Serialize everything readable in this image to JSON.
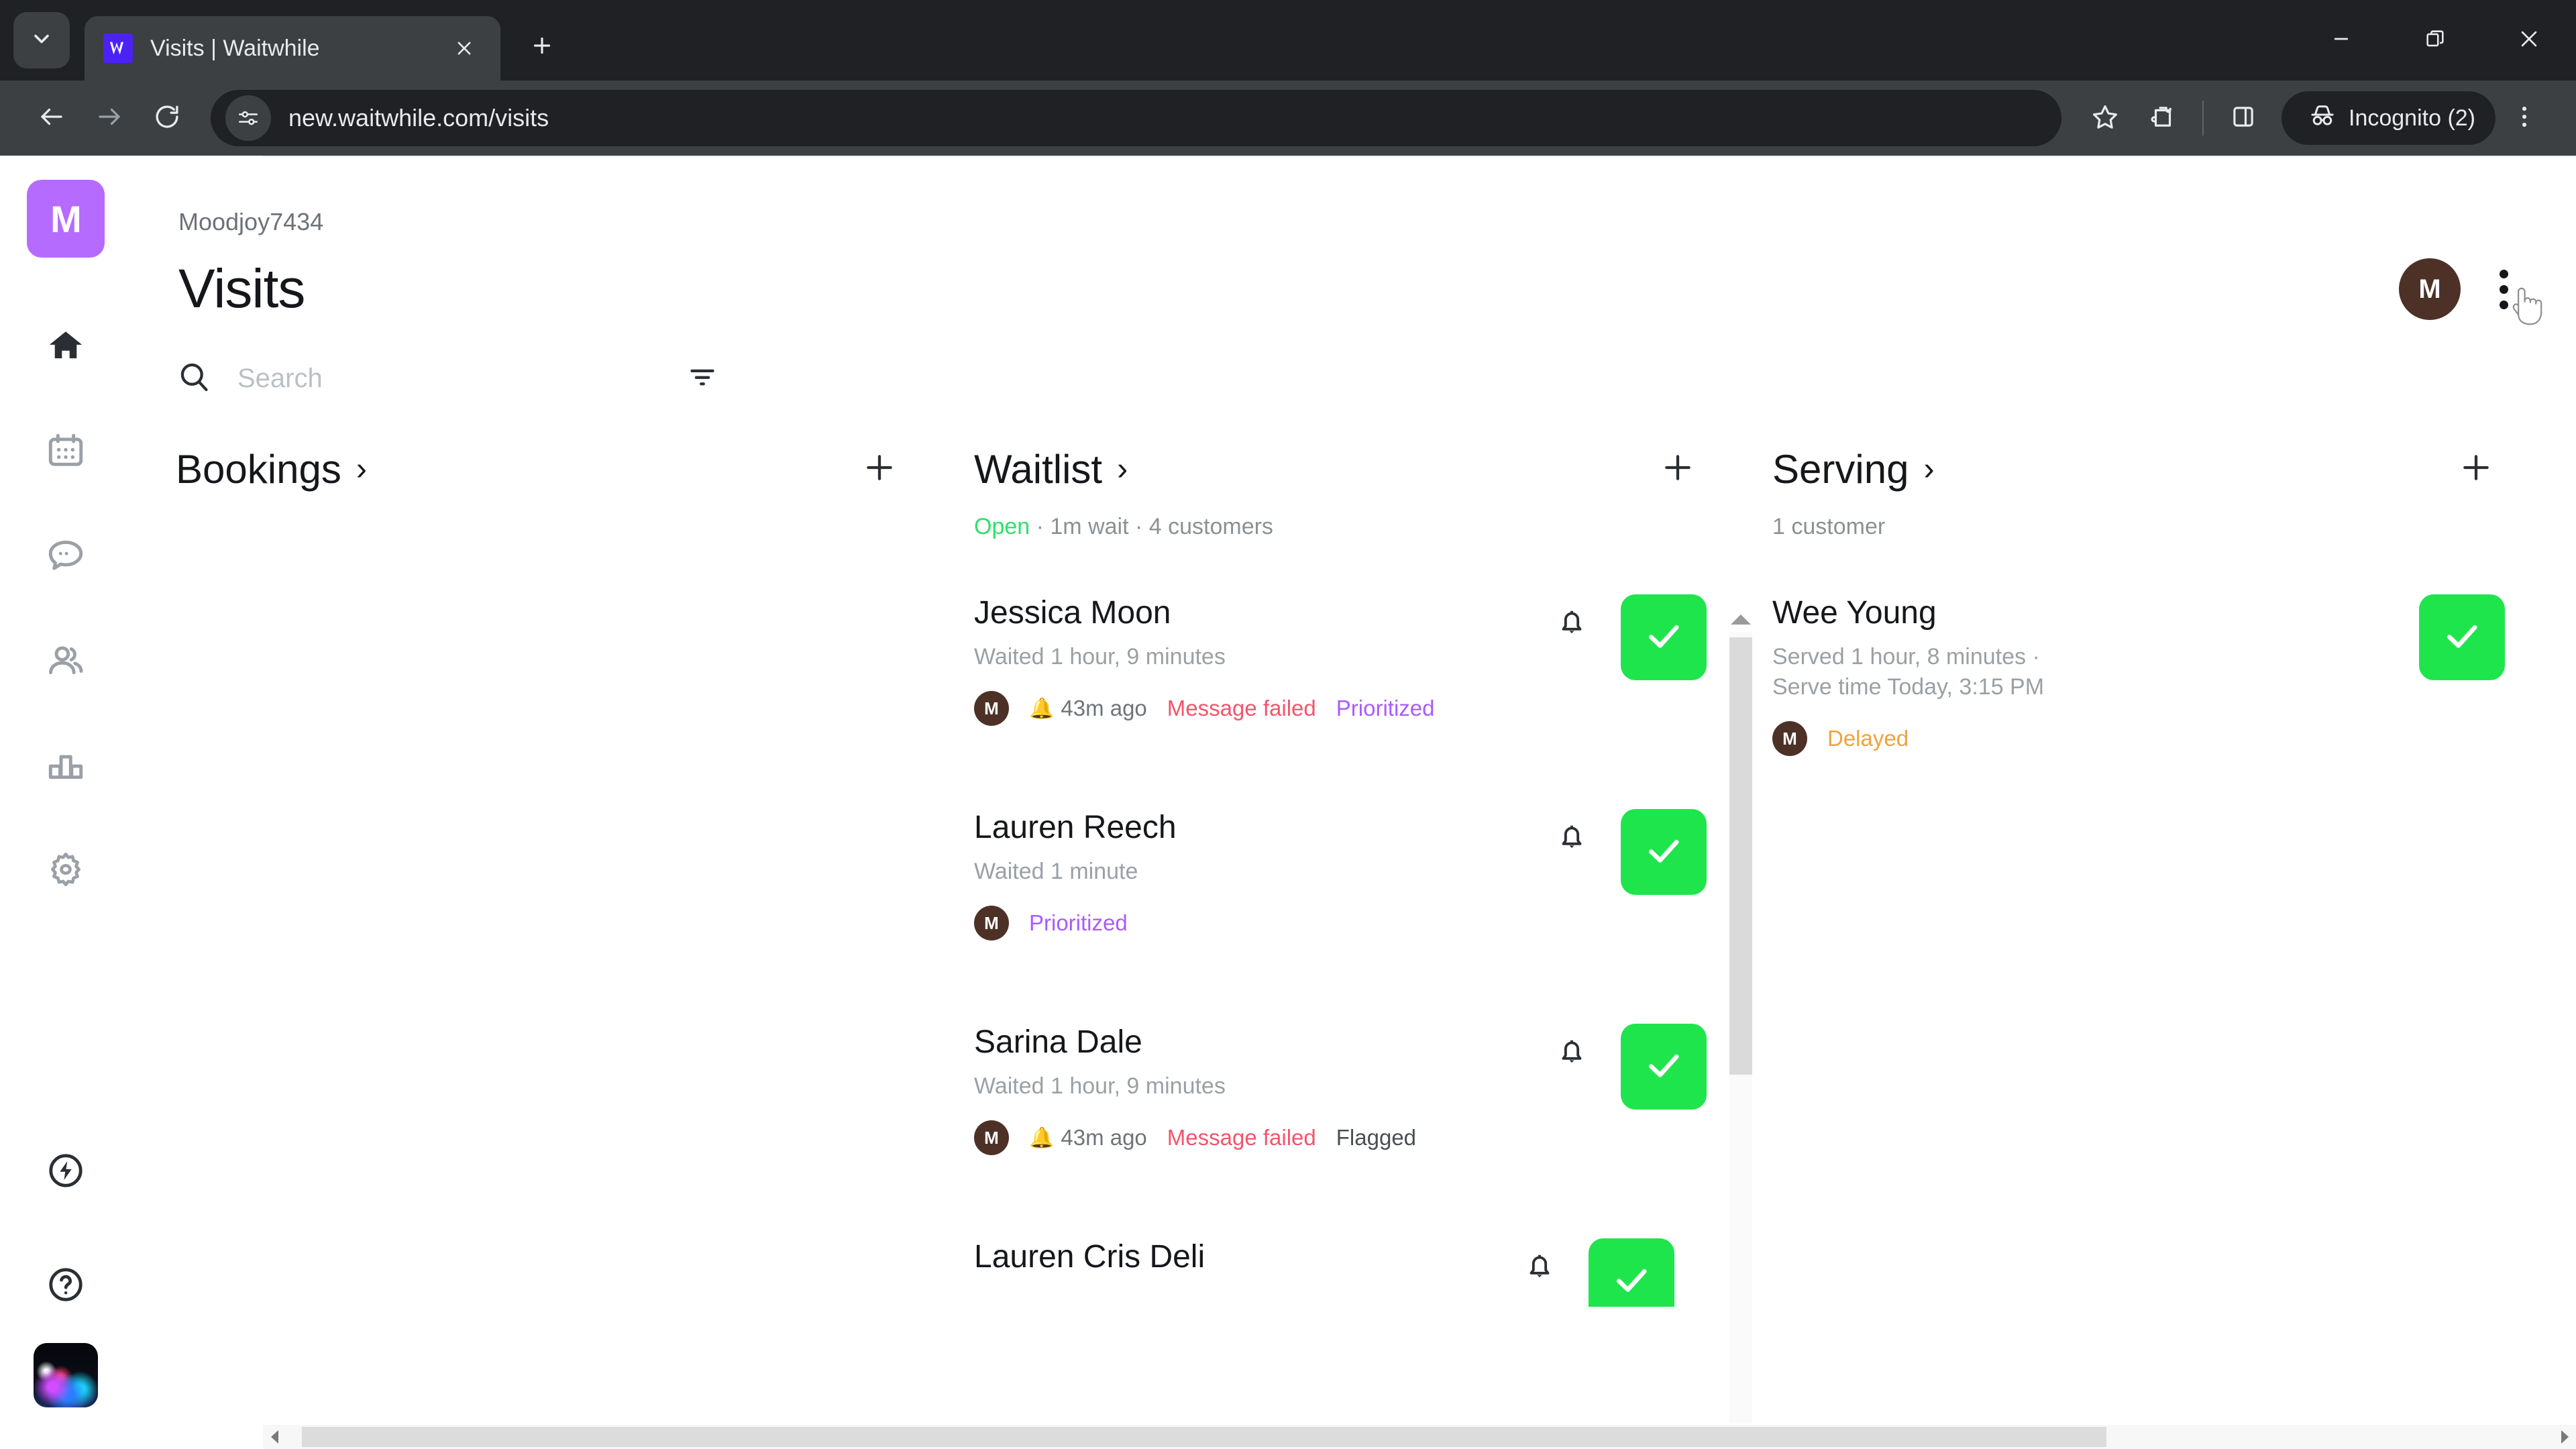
{
  "browser": {
    "tab": {
      "title": "Visits | Waitwhile",
      "favicon_icon": "waitwhile-logo-icon"
    },
    "tab_list_icon": "chevron-down-icon",
    "new_tab_icon": "plus-icon",
    "close_tab_icon": "close-icon",
    "window": {
      "minimize": "minimize-icon",
      "maximize": "restore-icon",
      "close": "close-icon"
    },
    "nav": {
      "back_icon": "arrow-left-icon",
      "forward_icon": "arrow-right-icon",
      "reload_icon": "reload-icon"
    },
    "omnibox": {
      "url": "new.waitwhile.com/visits",
      "site_info_icon": "site-settings-icon"
    },
    "actions": {
      "bookmark_icon": "star-icon",
      "extensions_icon": "extensions-icon",
      "side_panel_icon": "side-panel-icon",
      "menu_icon": "three-dot-menu-icon",
      "incognito_label": "Incognito (2)",
      "incognito_icon": "incognito-hat-icon"
    }
  },
  "sidebar": {
    "logo_initial": "M",
    "items": [
      {
        "name": "home",
        "icon": "home-icon",
        "active": true
      },
      {
        "name": "calendar",
        "icon": "calendar-icon",
        "active": false
      },
      {
        "name": "messages",
        "icon": "chat-bubble-icon",
        "active": false
      },
      {
        "name": "customers",
        "icon": "people-icon",
        "active": false
      },
      {
        "name": "analytics",
        "icon": "bar-chart-icon",
        "active": false
      },
      {
        "name": "settings",
        "icon": "gear-icon",
        "active": false
      }
    ],
    "bottom_items": [
      {
        "name": "automations",
        "icon": "lightning-bolt-icon"
      },
      {
        "name": "help",
        "icon": "question-mark-icon"
      },
      {
        "name": "account-avatar",
        "icon": "avatar-image"
      }
    ]
  },
  "header": {
    "org_name": "Moodjoy7434",
    "page_title": "Visits",
    "user_avatar_initial": "M",
    "kebab_icon": "three-dot-menu-icon"
  },
  "search": {
    "placeholder": "Search",
    "value": "",
    "search_icon": "search-icon",
    "filter_icon": "filter-icon"
  },
  "columns": [
    {
      "title": "Bookings",
      "chevron": "›",
      "add_icon": "plus-icon",
      "meta": {
        "status": "",
        "text": ""
      },
      "cards": []
    },
    {
      "title": "Waitlist",
      "chevron": "›",
      "add_icon": "plus-icon",
      "meta": {
        "status": "Open",
        "text": " · 1m wait · 4 customers"
      },
      "cards": [
        {
          "name": "Jessica Moon",
          "sub": "Waited 1 hour, 9 minutes",
          "avatar_initial": "M",
          "time": "43m ago",
          "has_bell_emoji": true,
          "tags": [
            {
              "label": "Message failed",
              "kind": "failed"
            },
            {
              "label": "Prioritized",
              "kind": "prioritized"
            }
          ],
          "bell_icon": "notification-bell-icon",
          "check_icon": "checkmark-icon"
        },
        {
          "name": "Lauren Reech",
          "sub": "Waited 1 minute",
          "avatar_initial": "M",
          "time": "",
          "has_bell_emoji": false,
          "tags": [
            {
              "label": "Prioritized",
              "kind": "prioritized"
            }
          ],
          "bell_icon": "notification-bell-icon",
          "check_icon": "checkmark-icon"
        },
        {
          "name": "Sarina Dale",
          "sub": "Waited 1 hour, 9 minutes",
          "avatar_initial": "M",
          "time": "43m ago",
          "has_bell_emoji": true,
          "tags": [
            {
              "label": "Message failed",
              "kind": "failed"
            },
            {
              "label": "Flagged",
              "kind": "flagged"
            }
          ],
          "bell_icon": "notification-bell-icon",
          "check_icon": "checkmark-icon"
        },
        {
          "name": "Lauren Cris Deli",
          "sub": "",
          "avatar_initial": "M",
          "time": "",
          "has_bell_emoji": false,
          "tags": [],
          "bell_icon": "notification-bell-icon",
          "check_icon": "checkmark-icon",
          "partial": true
        }
      ]
    },
    {
      "title": "Serving",
      "chevron": "›",
      "add_icon": "plus-icon",
      "meta": {
        "status": "",
        "text": "1 customer"
      },
      "cards": [
        {
          "name": "Wee Young",
          "sub": "Served 1 hour, 8 minutes ·\nServe time Today, 3:15 PM",
          "avatar_initial": "M",
          "time": "",
          "has_bell_emoji": false,
          "tags": [
            {
              "label": "Delayed",
              "kind": "delayed"
            }
          ],
          "check_icon": "checkmark-icon",
          "no_bell": true
        }
      ]
    }
  ],
  "scrollbars": {
    "vertical_up_icon": "scroll-up-arrow-icon",
    "vertical_down_icon": "scroll-down-arrow-icon",
    "horizontal_left_icon": "scroll-left-arrow-icon",
    "horizontal_right_icon": "scroll-right-arrow-icon"
  },
  "colors": {
    "accent_green": "#1fe54d",
    "open_green": "#2ee06a",
    "failed_red": "#f4546b",
    "prioritized_purple": "#a95bff",
    "delayed_orange": "#f0a23c",
    "logo_purple": "#b66bff",
    "avatar_brown": "#4d3127",
    "browser_tabstrip": "#202124",
    "browser_toolbar": "#3c4043"
  }
}
